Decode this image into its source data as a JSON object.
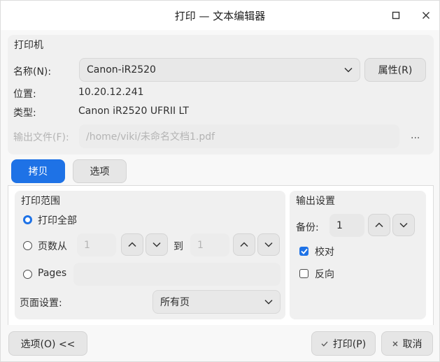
{
  "window": {
    "title": "打印 — 文本编辑器"
  },
  "printer": {
    "section_title": "打印机",
    "name_label": "名称(N):",
    "name_value": "Canon-iR2520",
    "properties_button": "属性(R)",
    "location_label": "位置:",
    "location_value": "10.20.12.241",
    "type_label": "类型:",
    "type_value": "Canon iR2520 UFRII LT",
    "output_file_label": "输出文件(F):",
    "output_file_value": "/home/viki/未命名文档1.pdf",
    "browse_button": "..."
  },
  "tabs": [
    {
      "label": "拷贝",
      "active": true
    },
    {
      "label": "选项",
      "active": false
    }
  ],
  "range": {
    "section_title": "打印范围",
    "all_label": "打印全部",
    "pages_from_label": "页数从",
    "from_value": "1",
    "to_label": "到",
    "to_value": "1",
    "pages_label": "Pages",
    "page_setting_label": "页面设置:",
    "page_setting_value": "所有页"
  },
  "output": {
    "section_title": "输出设置",
    "copies_label": "备份:",
    "copies_value": "1",
    "collate_label": "校对",
    "collate_checked": true,
    "reverse_label": "反向",
    "reverse_checked": false
  },
  "footer": {
    "options_button": "选项(O) <<",
    "print_button": "打印(P)",
    "cancel_button": "取消"
  },
  "colors": {
    "accent": "#1e72e6",
    "panel": "#f0f0f0",
    "disabled_text": "#b4b4b4"
  }
}
